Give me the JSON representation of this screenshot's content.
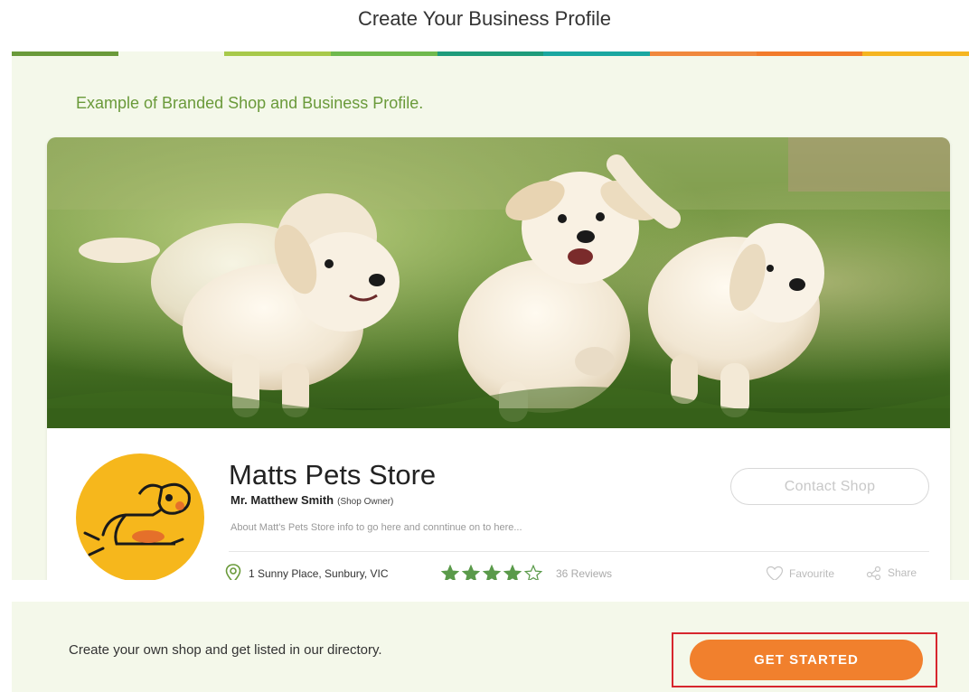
{
  "page_title": "Create Your Business Profile",
  "color_bar": [
    "#6a9a3a",
    "#f4f8ea",
    "#a7c94a",
    "#6fb94d",
    "#1e9c7b",
    "#1aa7a0",
    "#f0883d",
    "#f27b2b",
    "#f5b520"
  ],
  "example_label": "Example of Branded Shop and Business Profile.",
  "profile": {
    "shop_name": "Matts Pets Store",
    "owner_name": "Mr. Matthew Smith",
    "owner_role": "(Shop Owner)",
    "about": "About Matt's Pets Store info to go here and conntinue on to here...",
    "contact_label": "Contact Shop",
    "address": "1 Sunny Place, Sunbury, VIC",
    "rating": 4,
    "rating_max": 5,
    "reviews": "36 Reviews",
    "favourite_label": "Favourite",
    "share_label": "Share"
  },
  "icons": {
    "location": "map-pin-icon",
    "star": "star-icon",
    "favourite": "heart-icon",
    "share": "share-icon"
  },
  "cta": {
    "text": "Create your own shop and get listed in our directory.",
    "button_label": "GET STARTED"
  },
  "colors": {
    "accent_green": "#6a9a3a",
    "star_green": "#5a9a4a",
    "button_orange": "#f1802d",
    "logo_yellow": "#f6b71c",
    "highlight_red": "#d7262e",
    "panel_bg": "#f4f8ea"
  }
}
